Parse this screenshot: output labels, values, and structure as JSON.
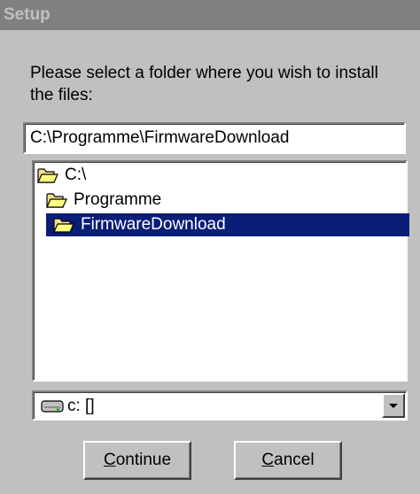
{
  "window": {
    "title": "Setup"
  },
  "prompt": {
    "text": "Please select a folder where you wish to install the files:"
  },
  "path_field": {
    "value": "C:\\Programme\\FirmwareDownload"
  },
  "folder_tree": {
    "items": [
      {
        "label": "C:\\",
        "icon": "open-folder-icon",
        "level": 0,
        "selected": false
      },
      {
        "label": "Programme",
        "icon": "open-folder-icon",
        "level": 1,
        "selected": false
      },
      {
        "label": "FirmwareDownload",
        "icon": "open-folder-icon",
        "level": 2,
        "selected": true
      }
    ]
  },
  "drive_select": {
    "value": "c: []",
    "icon": "drive-icon"
  },
  "buttons": {
    "continue": {
      "mnemonic": "C",
      "rest": "ontinue"
    },
    "cancel": {
      "mnemonic": "C",
      "rest": "ancel"
    }
  },
  "colors": {
    "title_bar": "#808080",
    "dialog_bg": "#c0c0c0",
    "selection": "#0a1e78"
  }
}
